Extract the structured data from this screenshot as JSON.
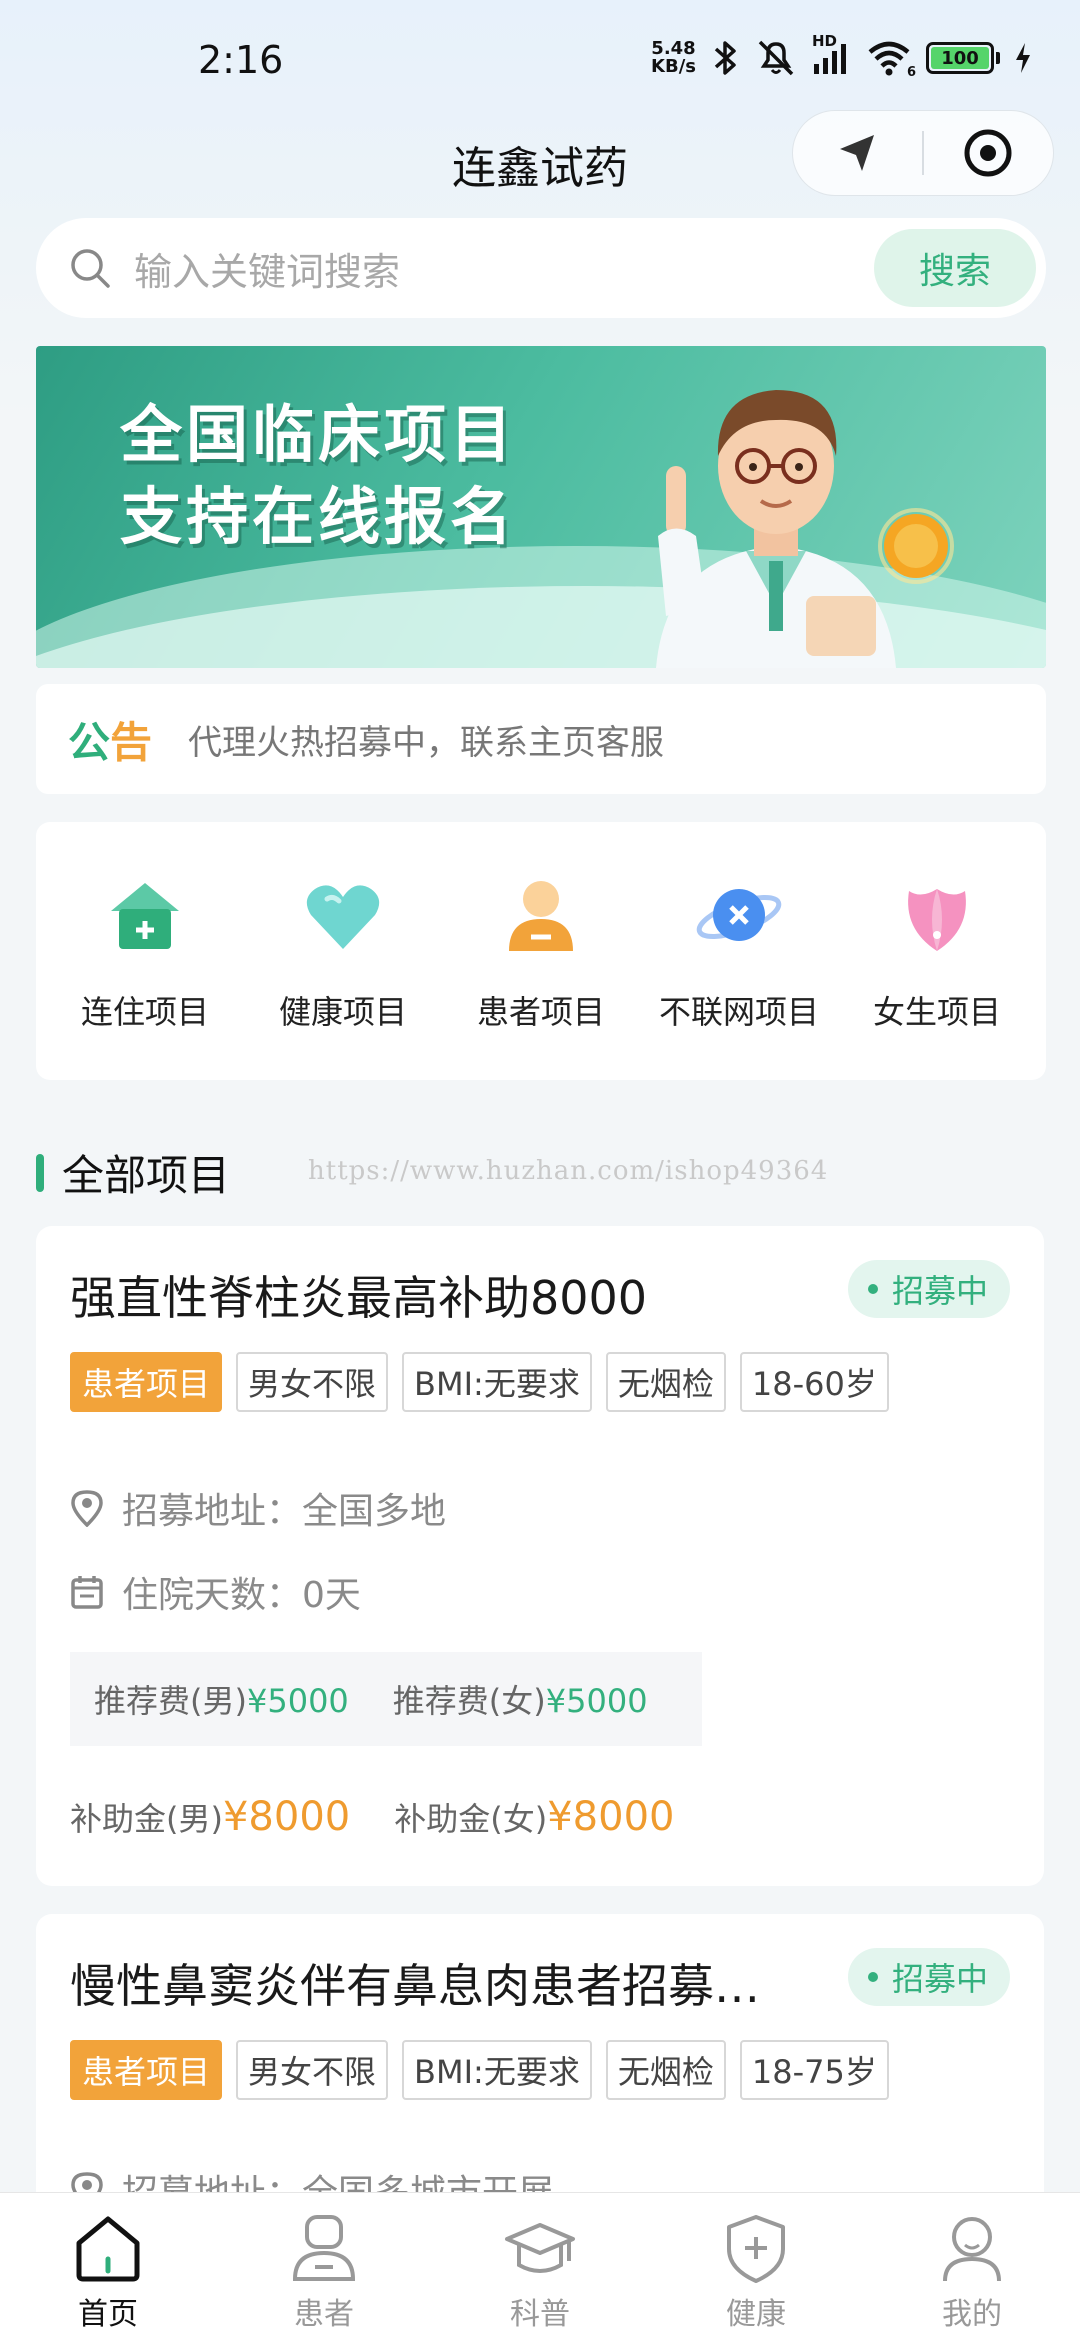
{
  "status_bar": {
    "time": "2:16",
    "net_speed_value": "5.48",
    "net_speed_unit": "KB/s",
    "signal_label": "HD",
    "wifi_label": "6",
    "battery": "100"
  },
  "header": {
    "title": "连鑫试药"
  },
  "search": {
    "placeholder": "输入关键词搜索",
    "button": "搜索"
  },
  "banner": {
    "line1": "全国临床项目",
    "line2": "支持在线报名"
  },
  "notice": {
    "tag_part1": "公",
    "tag_part2": "告",
    "text": "代理火热招募中，联系主页客服"
  },
  "categories": [
    {
      "label": "连住项目",
      "icon": "house-plus-icon"
    },
    {
      "label": "健康项目",
      "icon": "heart-icon"
    },
    {
      "label": "患者项目",
      "icon": "patient-icon"
    },
    {
      "label": "不联网项目",
      "icon": "planet-x-icon"
    },
    {
      "label": "女生项目",
      "icon": "tulip-icon"
    }
  ],
  "section": {
    "title": "全部项目",
    "watermark": "https://www.huzhan.com/ishop49364"
  },
  "projects": [
    {
      "title": "强直性脊柱炎最高补助8000",
      "status": "招募中",
      "tags": [
        "患者项目",
        "男女不限",
        "BMI:无要求",
        "无烟检",
        "18-60岁"
      ],
      "address_label": "招募地址：",
      "address": "全国多地",
      "days_label": "住院天数：",
      "days": "0天",
      "referral_male_label": "推荐费(男)",
      "referral_male": "¥5000",
      "referral_female_label": "推荐费(女)",
      "referral_female": "¥5000",
      "subsidy_male_label": "补助金(男)",
      "subsidy_male": "¥8000",
      "subsidy_female_label": "补助金(女)",
      "subsidy_female": "¥8000"
    },
    {
      "title": "慢性鼻窦炎伴有鼻息肉患者招募…",
      "status": "招募中",
      "tags": [
        "患者项目",
        "男女不限",
        "BMI:无要求",
        "无烟检",
        "18-75岁"
      ],
      "address_label": "招募地址：",
      "address": "全国多城市开展"
    }
  ],
  "bottom_nav": [
    {
      "label": "首页",
      "icon": "home-icon",
      "active": true
    },
    {
      "label": "患者",
      "icon": "patient-icon",
      "active": false
    },
    {
      "label": "科普",
      "icon": "graduation-cap-icon",
      "active": false
    },
    {
      "label": "健康",
      "icon": "shield-plus-icon",
      "active": false
    },
    {
      "label": "我的",
      "icon": "user-icon",
      "active": false
    }
  ],
  "colors": {
    "accent_green": "#33b07e",
    "accent_orange": "#f2a33a",
    "subsidy_orange": "#ef9b2f"
  }
}
